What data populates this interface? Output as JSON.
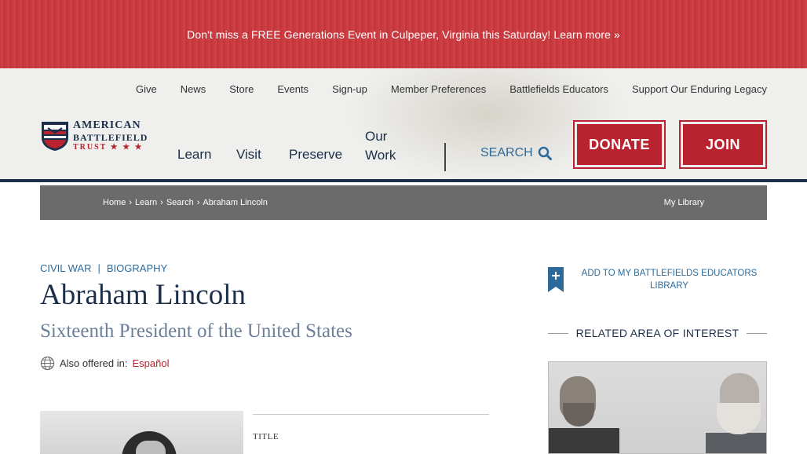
{
  "promo": {
    "text": "Don't miss a FREE Generations Event in Culpeper, Virginia this Saturday! Learn more »"
  },
  "utility_nav": [
    {
      "label": "Give"
    },
    {
      "label": "News"
    },
    {
      "label": "Store"
    },
    {
      "label": "Events"
    },
    {
      "label": "Sign-up"
    },
    {
      "label": "Member Preferences"
    },
    {
      "label": "Battlefields Educators"
    },
    {
      "label": "Support Our Enduring Legacy"
    }
  ],
  "logo": {
    "line1": "AMERICAN",
    "line2": "BATTLEFIELD",
    "line3": "TRUST ★ ★ ★"
  },
  "main_nav": {
    "learn": "Learn",
    "visit": "Visit",
    "preserve": "Preserve",
    "our_work": "Our Work"
  },
  "search": {
    "label": "SEARCH",
    "icon": "search-icon"
  },
  "cta": {
    "donate": "DONATE",
    "join": "JOIN"
  },
  "breadcrumb": {
    "items": [
      {
        "label": "Home"
      },
      {
        "label": "Learn"
      },
      {
        "label": "Search"
      },
      {
        "label": "Abraham Lincoln"
      }
    ],
    "separator": "›",
    "my_library": "My Library"
  },
  "article": {
    "category1": "CIVIL WAR",
    "category_sep": "|",
    "category2": "BIOGRAPHY",
    "title": "Abraham Lincoln",
    "subtitle": "Sixteenth President of the United States",
    "also_offered_label": "Also offered in:",
    "also_offered_link": "Español",
    "meta_label": "TITLE"
  },
  "sidebar": {
    "add_library": "ADD TO MY BATTLEFIELDS EDUCATORS LIBRARY",
    "related_heading": "RELATED AREA OF INTEREST"
  },
  "colors": {
    "navy": "#1c2f4a",
    "red": "#b8232f",
    "link_blue": "#2d6a9a",
    "breadcrumb_bg": "#6b6b6b"
  }
}
